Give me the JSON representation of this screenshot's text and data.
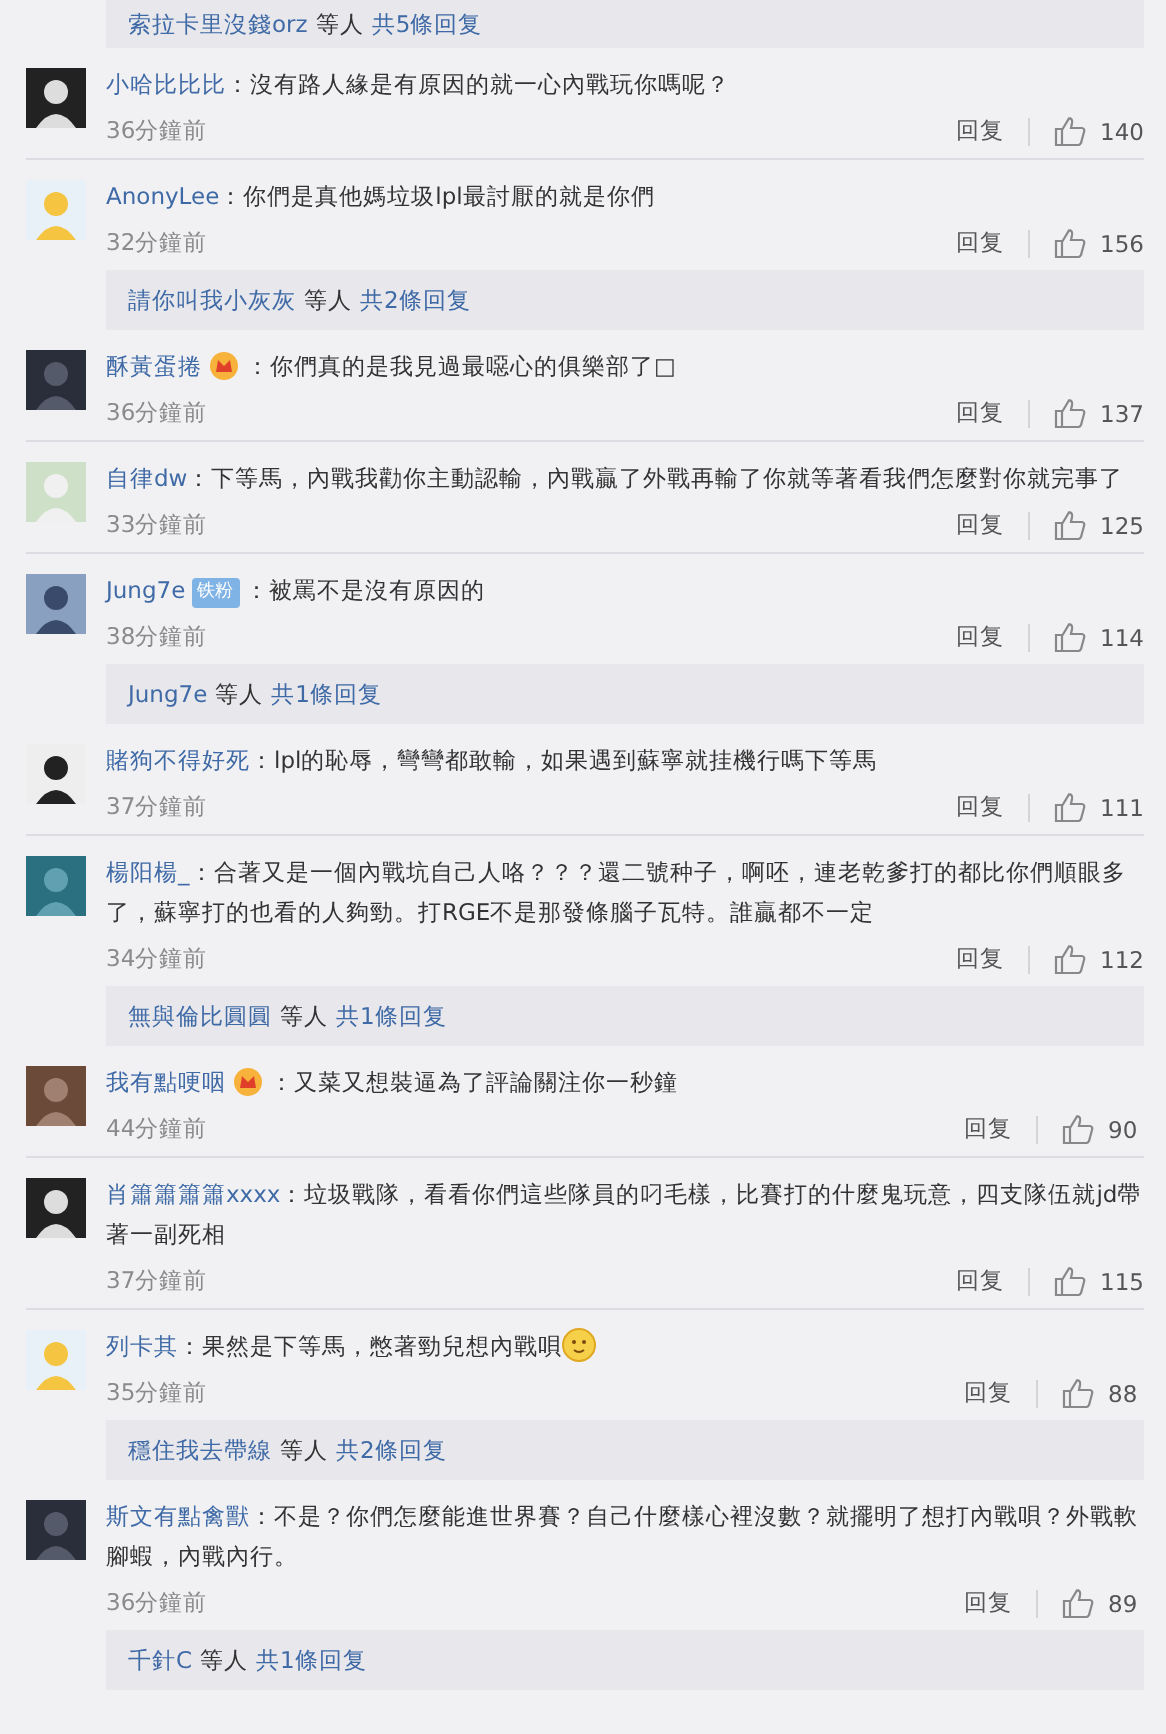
{
  "items": [
    {
      "kind": "thread",
      "users": "索拉卡里沒錢orz",
      "others": "等人",
      "total": "共5條回复"
    },
    {
      "kind": "comment",
      "user": "小哈比比比",
      "text": "：沒有路人緣是有原因的就一心內戰玩你嗎呢？",
      "time": "36分鐘前",
      "reply": "回复",
      "likes": "140"
    },
    {
      "kind": "comment",
      "user": "AnonyLee",
      "text": "：你們是真他媽垃圾lpl最討厭的就是你們",
      "time": "32分鐘前",
      "reply": "回复",
      "likes": "156"
    },
    {
      "kind": "thread",
      "users": "請你叫我小灰灰",
      "others": "等人",
      "total": "共2條回复"
    },
    {
      "kind": "comment",
      "user": "酥黃蛋捲",
      "badge": {
        "kind": "vip"
      },
      "text": "：你們真的是我見過最噁心的俱樂部了□",
      "time": "36分鐘前",
      "reply": "回复",
      "likes": "137"
    },
    {
      "kind": "comment",
      "user": "自律dw",
      "text": "：下等馬，內戰我勸你主動認輸，內戰贏了外戰再輸了你就等著看我們怎麼對你就完事了",
      "time": "33分鐘前",
      "reply": "回复",
      "likes": "125"
    },
    {
      "kind": "comment",
      "user": "Jung7e",
      "badge": {
        "kind": "fan",
        "label": "铁粉"
      },
      "text": "：被罵不是沒有原因的",
      "time": "38分鐘前",
      "reply": "回复",
      "likes": "114"
    },
    {
      "kind": "thread",
      "users": "Jung7e",
      "others": "等人",
      "total": "共1條回复"
    },
    {
      "kind": "comment",
      "user": "賭狗不得好死",
      "text": "：lpl的恥辱，彎彎都敢輸，如果遇到蘇寧就挂機行嗎下等馬",
      "time": "37分鐘前",
      "reply": "回复",
      "likes": "111"
    },
    {
      "kind": "comment",
      "user": "楊阳楊_",
      "text": "：合著又是一個內戰坑自己人咯？？？還二號种子，啊呸，連老乾爹打的都比你們順眼多了，蘇寧打的也看的人夠勁。打RGE不是那發條腦子瓦特。誰贏都不一定",
      "time": "34分鐘前",
      "reply": "回复",
      "likes": "112"
    },
    {
      "kind": "thread",
      "users": "無與倫比圓圓",
      "others": "等人",
      "total": "共1條回复"
    },
    {
      "kind": "comment",
      "user": "我有點哽咽",
      "badge": {
        "kind": "vip"
      },
      "text": "：又菜又想裝逼為了評論關注你一秒鐘",
      "time": "44分鐘前",
      "reply": "回复",
      "likes": "90"
    },
    {
      "kind": "comment",
      "user": "肖簫簫簫簫xxxx",
      "text": "：垃圾戰隊，看看你們這些隊員的叼毛樣，比賽打的什麼鬼玩意，四支隊伍就jd帶著一副死相",
      "time": "37分鐘前",
      "reply": "回复",
      "likes": "115"
    },
    {
      "kind": "comment",
      "user": "列卡其",
      "text": "：果然是下等馬，憋著勁兒想內戰唄",
      "emoji": true,
      "time": "35分鐘前",
      "reply": "回复",
      "likes": "88"
    },
    {
      "kind": "thread",
      "users": "穩住我去帶線",
      "others": "等人",
      "total": "共2條回复"
    },
    {
      "kind": "comment",
      "user": "斯文有點禽獸",
      "text": "：不是？你們怎麼能進世界賽？自己什麼樣心裡沒數？就擺明了想打內戰唄？外戰軟腳蝦，內戰內行。",
      "time": "36分鐘前",
      "reply": "回复",
      "likes": "89"
    },
    {
      "kind": "thread",
      "users": "千針C",
      "others": "等人",
      "total": "共1條回复"
    }
  ]
}
